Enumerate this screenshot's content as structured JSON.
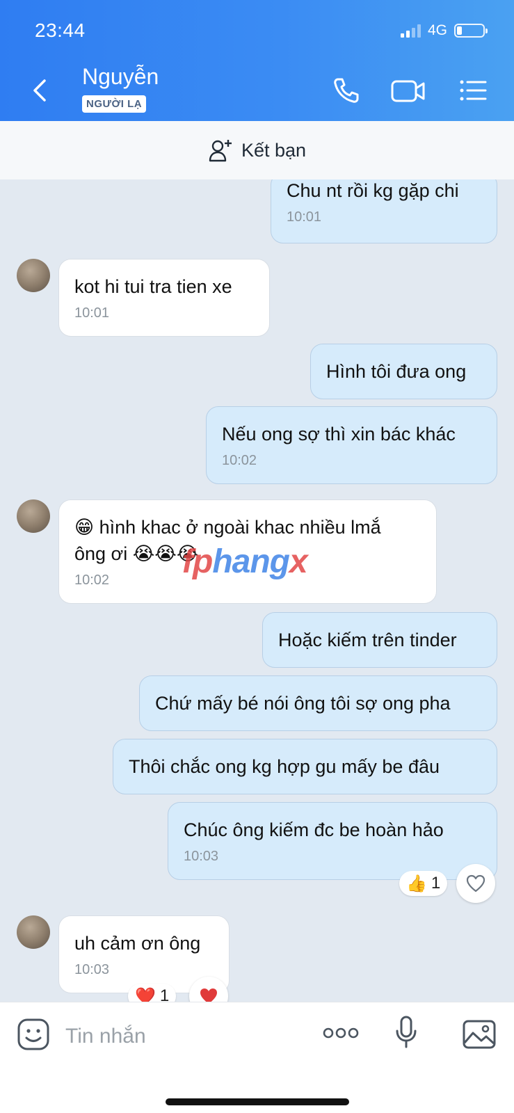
{
  "status_bar": {
    "time": "23:44",
    "network": "4G"
  },
  "header": {
    "contact_name": "Nguyễn",
    "badge": "NGƯỜI LẠ"
  },
  "add_friend": {
    "label": "Kết bạn"
  },
  "messages": [
    {
      "side": "mine",
      "text": "Chu nt rồi kg gặp chi",
      "time": "10:01"
    },
    {
      "side": "theirs",
      "text": "kot hi tui tra tien xe",
      "time": "10:01"
    },
    {
      "side": "mine",
      "text": "Hình tôi đưa ong"
    },
    {
      "side": "mine",
      "text": "Nếu ong sợ thì xin bác khác",
      "time": "10:02"
    },
    {
      "side": "theirs",
      "line1": "😁 hình khac ở ngoài khac nhiều lmắ",
      "line2": "ông ơi 😭😭😭",
      "time": "10:02"
    },
    {
      "side": "mine",
      "text": "Hoặc kiếm trên tinder"
    },
    {
      "side": "mine",
      "text": "Chứ mấy bé nói ông tôi sợ ong pha"
    },
    {
      "side": "mine",
      "text": "Thôi chắc ong kg hợp gu mấy be đâu"
    },
    {
      "side": "mine",
      "text": "Chúc ông kiếm đc be hoàn hảo",
      "time": "10:03",
      "reaction_emoji": "👍",
      "reaction_count": "1"
    },
    {
      "side": "theirs",
      "text": "uh cảm ơn ông",
      "time": "10:03",
      "reaction_emoji": "❤️",
      "reaction_count": "1"
    }
  ],
  "watermark": {
    "part1": "fp",
    "part2": "hang",
    "part3": "x"
  },
  "input": {
    "placeholder": "Tin nhắn"
  },
  "colors": {
    "header_blue": "#2f7df2",
    "my_bubble": "#d6ebfb",
    "their_bubble": "#ffffff",
    "chat_bg": "#e2e9f1"
  }
}
